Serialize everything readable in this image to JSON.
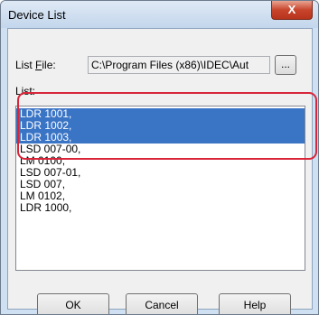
{
  "window": {
    "title": "Device List",
    "close_glyph": "X"
  },
  "list_file": {
    "label_prefix": "List ",
    "label_hotkey": "F",
    "label_suffix": "ile:",
    "value": "C:\\Program Files (x86)\\IDEC\\Aut",
    "browse_label": "..."
  },
  "list": {
    "label": "List:",
    "items": [
      {
        "text": "LDR 1001,",
        "selected": true
      },
      {
        "text": "LDR 1002,",
        "selected": true
      },
      {
        "text": "LDR 1003,",
        "selected": true
      },
      {
        "text": "LSD 007-00,",
        "selected": false
      },
      {
        "text": "LM 0100,",
        "selected": false
      },
      {
        "text": "LSD 007-01,",
        "selected": false
      },
      {
        "text": "LSD 007,",
        "selected": false
      },
      {
        "text": "LM 0102,",
        "selected": false
      },
      {
        "text": "LDR 1000,",
        "selected": false
      }
    ]
  },
  "buttons": {
    "ok": "OK",
    "cancel": "Cancel",
    "help": "Help"
  },
  "colors": {
    "selection": "#3a74c5",
    "highlight": "#d8253a",
    "close": "#c8452c"
  }
}
